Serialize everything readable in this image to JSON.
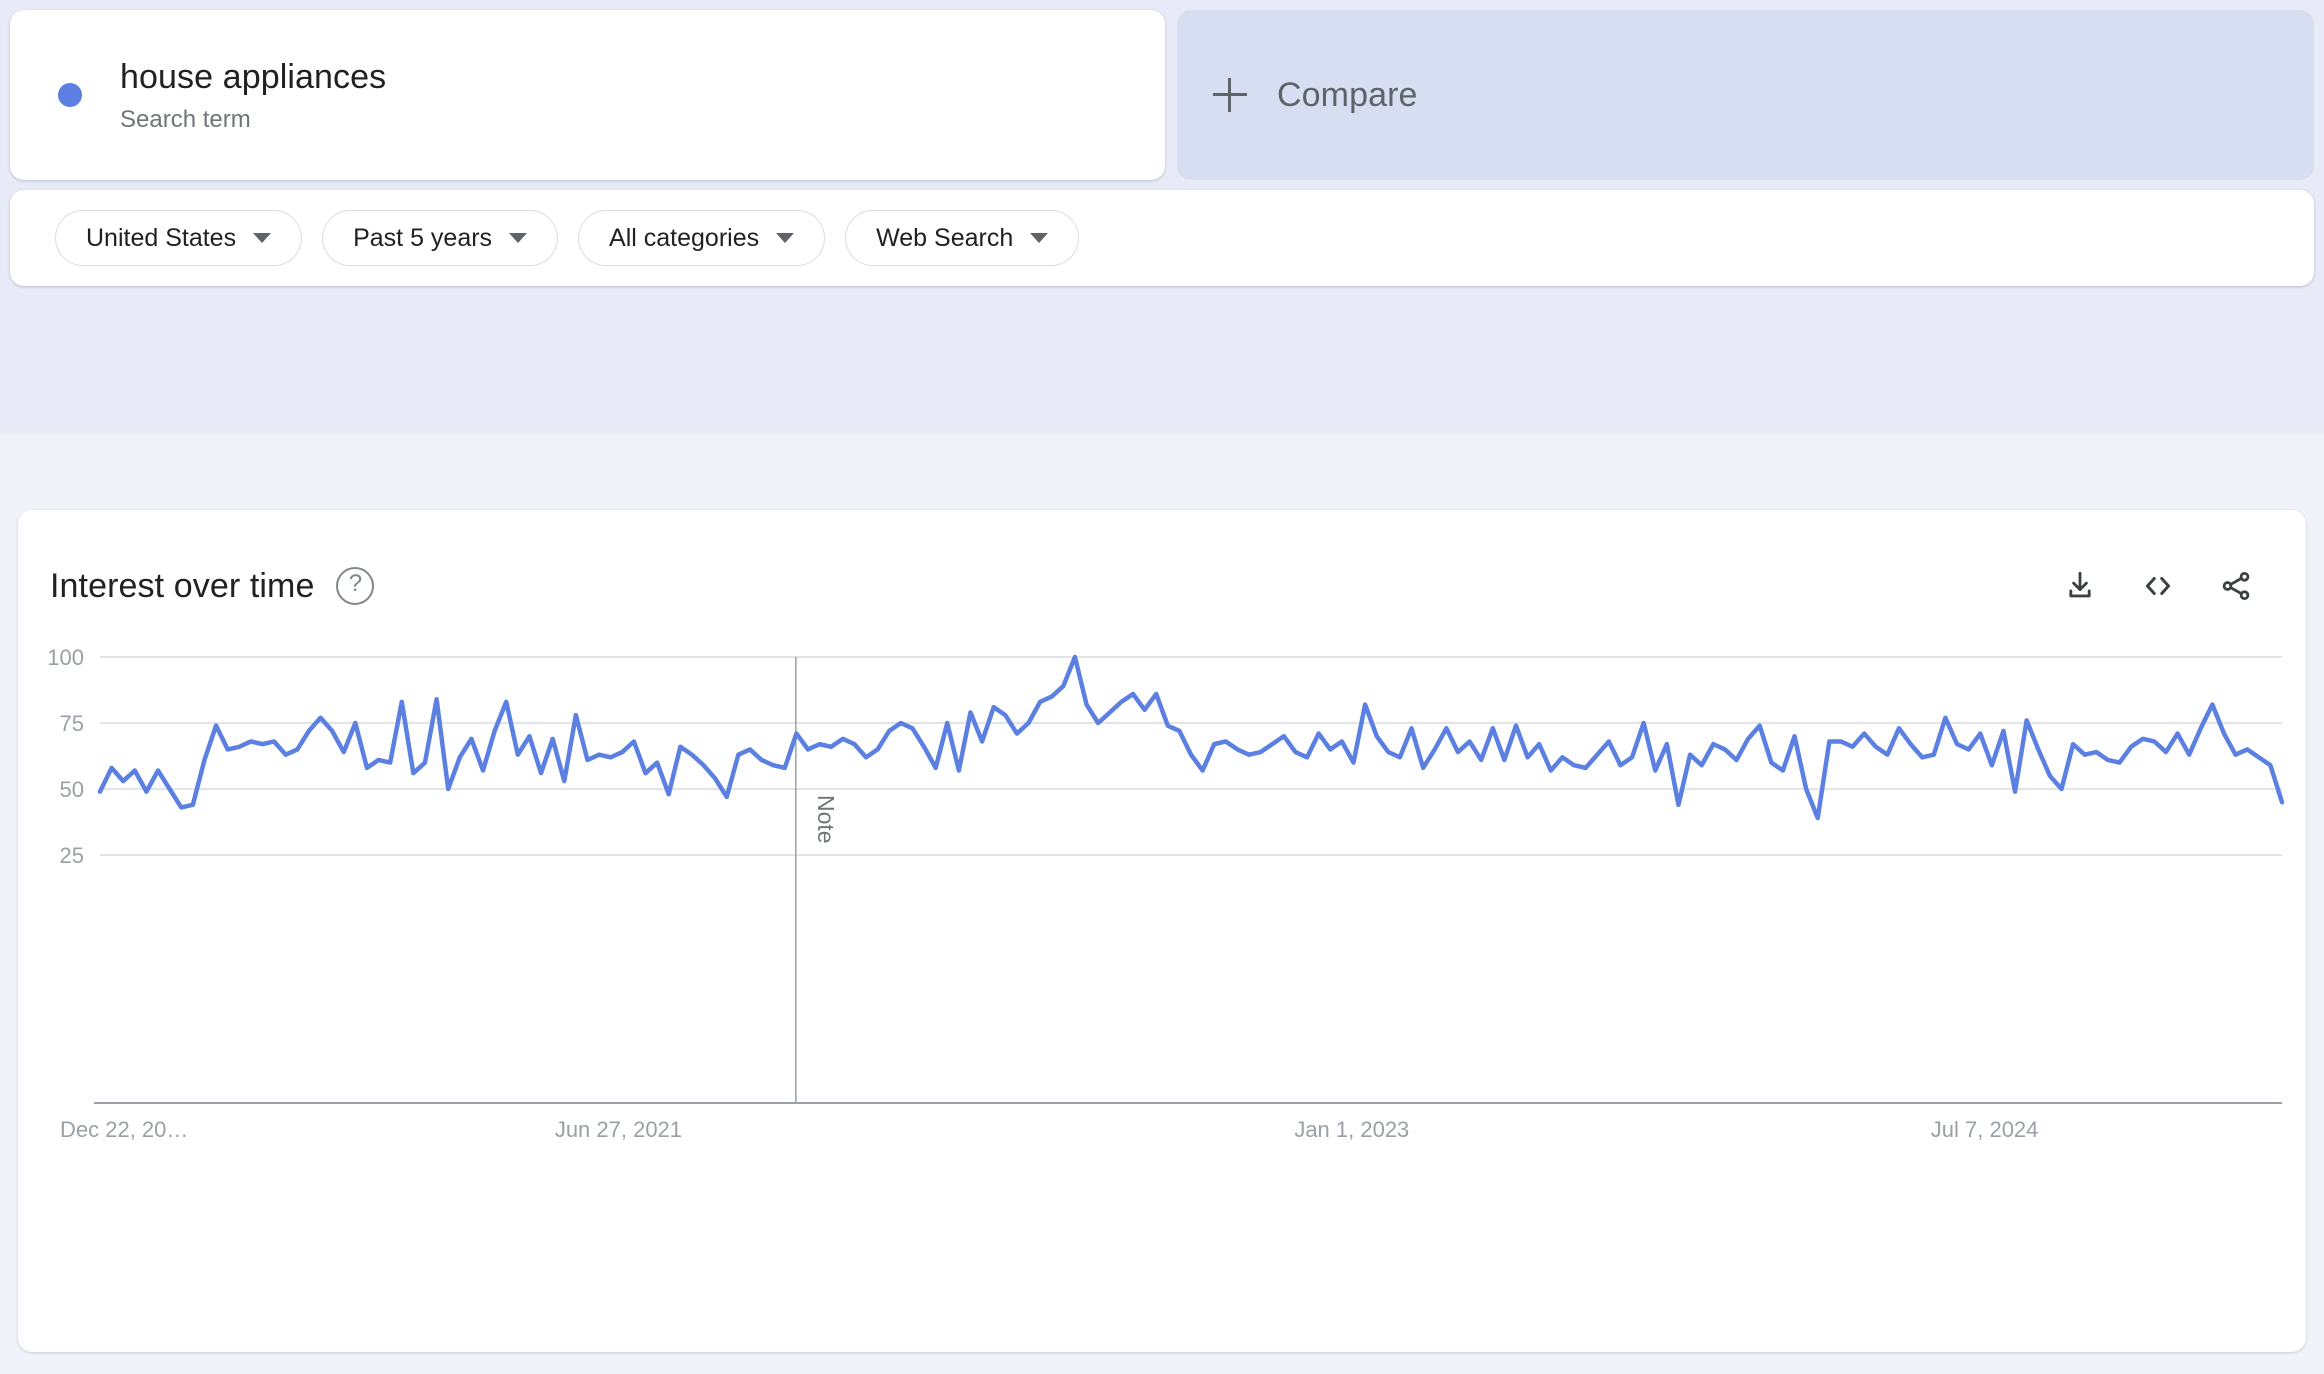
{
  "colors": {
    "series": "#5b80e2",
    "page_bg_top": "#e8ebf7",
    "page_bg_bottom": "#f2f3fa",
    "compare_card_bg": "#d7def2",
    "grid": "#dadce0",
    "muted_text": "#9aa0a6"
  },
  "search_term_card": {
    "term": "house appliances",
    "type_label": "Search term",
    "dot_icon": "series-color-dot"
  },
  "compare_card": {
    "label": "Compare",
    "icon": "plus-icon"
  },
  "filters": [
    {
      "name": "location",
      "label": "United States"
    },
    {
      "name": "time-range",
      "label": "Past 5 years"
    },
    {
      "name": "category",
      "label": "All categories"
    },
    {
      "name": "search-type",
      "label": "Web Search"
    }
  ],
  "panel": {
    "title": "Interest over time",
    "help_icon": "?",
    "actions": [
      {
        "name": "download",
        "icon": "download-icon"
      },
      {
        "name": "embed",
        "icon": "embed-code-icon"
      },
      {
        "name": "share",
        "icon": "share-icon"
      }
    ]
  },
  "chart_data": {
    "type": "line",
    "title": "Interest over time",
    "xlabel": "",
    "ylabel": "",
    "ylim": [
      0,
      100
    ],
    "yticks": [
      25,
      50,
      75,
      100
    ],
    "grid": true,
    "legend": "none",
    "xtick_labels": [
      "Dec 22, 20…",
      "Jun 27, 2021",
      "Jan 1, 2023",
      "Jul 7, 2024"
    ],
    "xtick_positions": [
      0,
      0.2376,
      0.5737,
      0.8637
    ],
    "annotations": [
      {
        "label": "Note",
        "type": "vertical-line",
        "position": 0.3189
      }
    ],
    "series": [
      {
        "name": "house appliances",
        "color": "#5b80e2",
        "values": [
          49,
          58,
          53,
          57,
          49,
          57,
          50,
          43,
          44,
          61,
          74,
          65,
          66,
          68,
          67,
          68,
          63,
          65,
          72,
          77,
          72,
          64,
          75,
          58,
          61,
          60,
          83,
          56,
          60,
          84,
          50,
          62,
          69,
          57,
          72,
          83,
          63,
          70,
          56,
          69,
          53,
          78,
          61,
          63,
          62,
          64,
          68,
          56,
          60,
          48,
          66,
          63,
          59,
          54,
          47,
          63,
          65,
          61,
          59,
          58,
          71,
          65,
          67,
          66,
          69,
          67,
          62,
          65,
          72,
          75,
          73,
          66,
          58,
          75,
          57,
          79,
          68,
          81,
          78,
          71,
          75,
          83,
          85,
          89,
          100,
          82,
          75,
          79,
          83,
          86,
          80,
          86,
          74,
          72,
          63,
          57,
          67,
          68,
          65,
          63,
          64,
          67,
          70,
          64,
          62,
          71,
          65,
          68,
          60,
          82,
          70,
          64,
          62,
          73,
          58,
          65,
          73,
          64,
          68,
          61,
          73,
          61,
          74,
          62,
          67,
          57,
          62,
          59,
          58,
          63,
          68,
          59,
          62,
          75,
          57,
          67,
          44,
          63,
          59,
          67,
          65,
          61,
          69,
          74,
          60,
          57,
          70,
          50,
          39,
          68,
          68,
          66,
          71,
          66,
          63,
          73,
          67,
          62,
          63,
          77,
          67,
          65,
          71,
          59,
          72,
          49,
          76,
          65,
          55,
          50,
          67,
          63,
          64,
          61,
          60,
          66,
          69,
          68,
          64,
          71,
          63,
          73,
          82,
          71,
          63,
          65,
          62,
          59,
          45
        ]
      }
    ]
  }
}
